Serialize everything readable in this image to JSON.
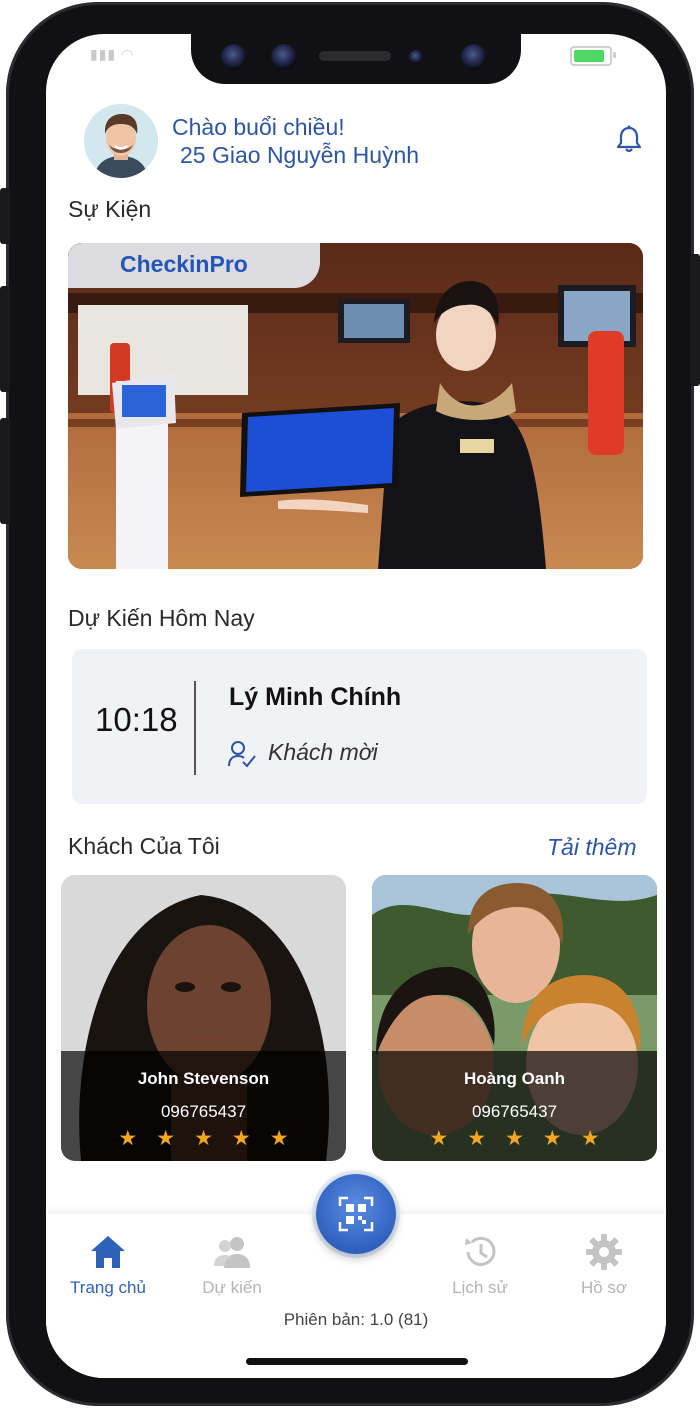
{
  "status_bar": {
    "signal_text": "▮▮▮ ◠"
  },
  "header": {
    "greeting": "Chào buổi chiều!",
    "user_name": "25 Giao Nguyễn Huỳnh"
  },
  "events": {
    "title": "Sự Kiện",
    "banner_logo": "CheckinPro"
  },
  "today": {
    "title": "Dự Kiến Hôm Nay",
    "time": "10:18",
    "name": "Lý Minh Chính",
    "role": "Khách mời"
  },
  "my_guests": {
    "title": "Khách Của Tôi",
    "load_more": "Tải thêm",
    "items": [
      {
        "name": "John Stevenson",
        "phone": "096765437",
        "stars": "★★★★★",
        "rating": 5
      },
      {
        "name": "Hoàng Oanh",
        "phone": "096765437",
        "stars": "★★★★★",
        "rating": 5
      }
    ]
  },
  "tabbar": {
    "tabs": [
      {
        "label": "Trang chủ",
        "icon": "home-icon",
        "active": true
      },
      {
        "label": "Dự kiến",
        "icon": "people-icon",
        "active": false
      },
      {
        "label": "Lịch sử",
        "icon": "history-icon",
        "active": false
      },
      {
        "label": "Hồ sơ",
        "icon": "gear-icon",
        "active": false
      }
    ],
    "scan_icon": "qr-scan-icon"
  },
  "version": "Phiên bản: 1.0 (81)",
  "colors": {
    "accent": "#2d55a4",
    "star": "#f5a623",
    "tab_active": "#2d62b8"
  }
}
